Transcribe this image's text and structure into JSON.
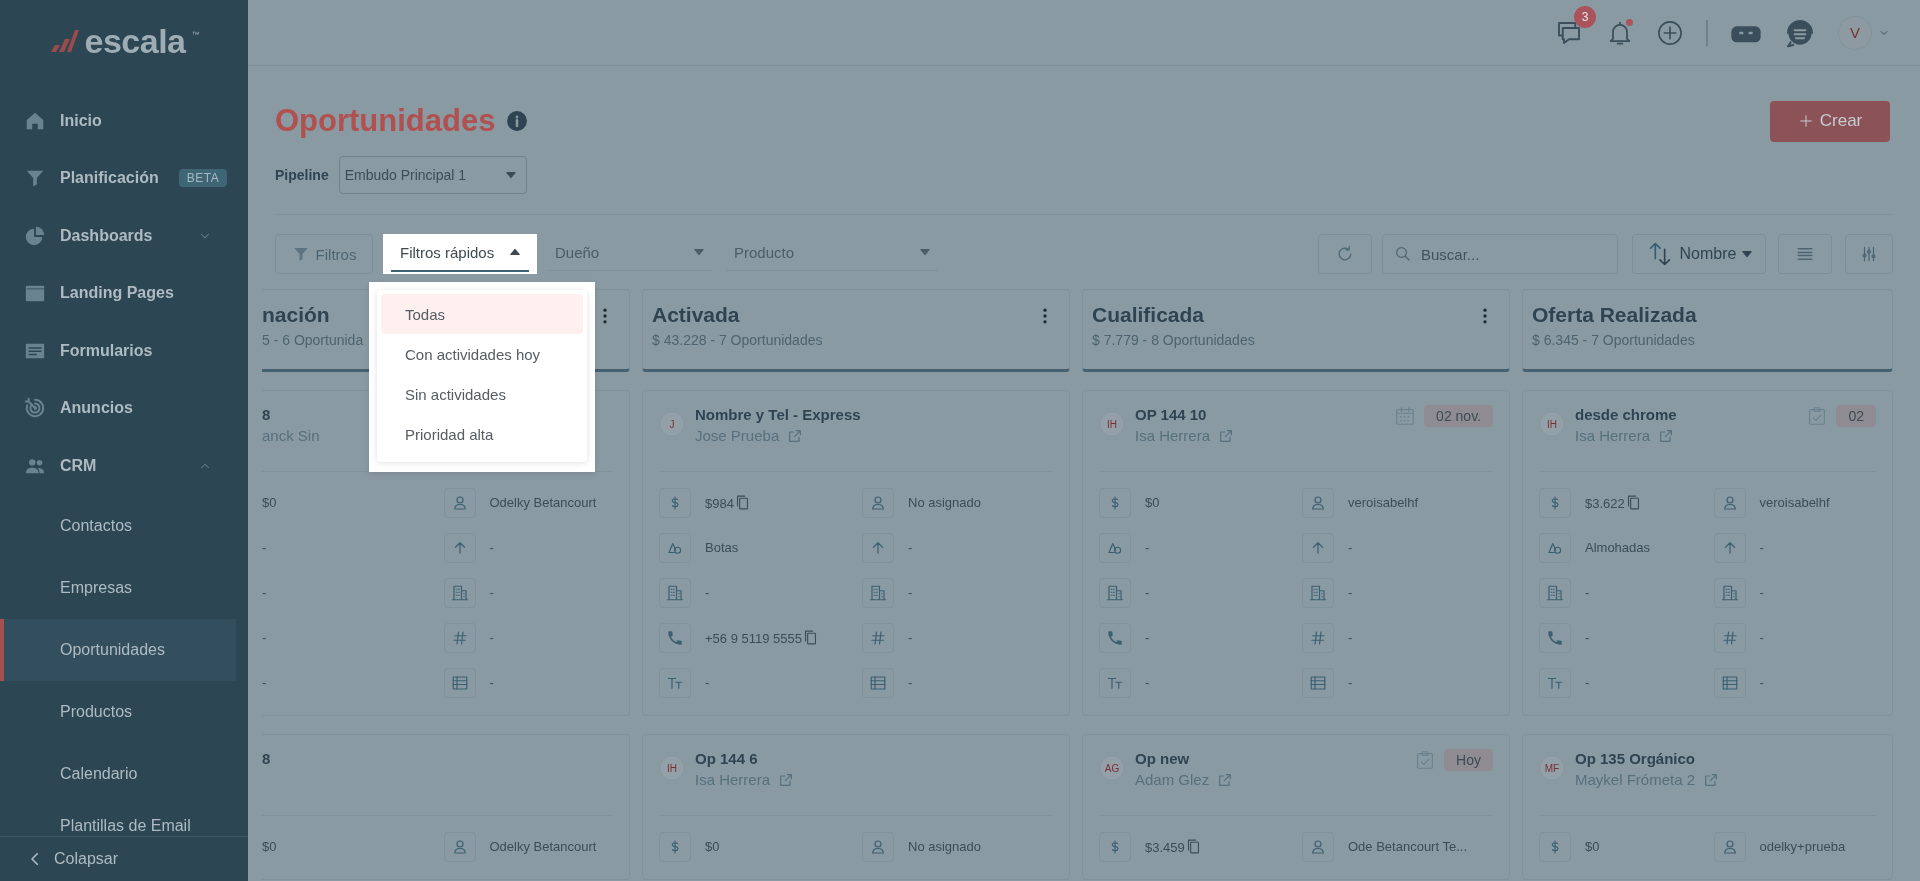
{
  "sidebar": {
    "logo": "escala",
    "logo_mark": "™",
    "items": [
      {
        "label": "Inicio",
        "kind": "home",
        "selected": false
      },
      {
        "label": "Planificación",
        "kind": "filter",
        "badge": "BETA",
        "selected": false
      },
      {
        "label": "Dashboards",
        "kind": "pie",
        "expanded": false,
        "selected": false
      },
      {
        "label": "Landing Pages",
        "kind": "window",
        "selected": false
      },
      {
        "label": "Formularios",
        "kind": "form",
        "selected": false
      },
      {
        "label": "Anuncios",
        "kind": "target",
        "selected": false
      },
      {
        "label": "CRM",
        "kind": "people",
        "expanded": true,
        "selected": false,
        "children": [
          {
            "label": "Contactos",
            "selected": false
          },
          {
            "label": "Empresas",
            "selected": false
          },
          {
            "label": "Oportunidades",
            "selected": true
          },
          {
            "label": "Productos",
            "selected": false
          },
          {
            "label": "Calendario",
            "selected": false
          },
          {
            "label": "Plantillas de Email",
            "selected": false
          }
        ]
      }
    ],
    "collapse": "Colapsar"
  },
  "topbar": {
    "messages_count": "3",
    "notifications_unread": true,
    "avatar": "V"
  },
  "page": {
    "title": "Oportunidades",
    "create_button": "Crear",
    "pipeline_label": "Pipeline",
    "pipeline_value": "Embudo Principal 1"
  },
  "filters": {
    "filters_button": "Filtros",
    "quick_filters": {
      "label": "Filtros rápidos",
      "expanded": true,
      "options": [
        {
          "label": "Todas",
          "selected": true
        },
        {
          "label": "Con actividades hoy",
          "selected": false
        },
        {
          "label": "Sin actividades",
          "selected": false
        },
        {
          "label": "Prioridad alta",
          "selected": false
        }
      ]
    },
    "owner_select": "Dueño",
    "product_select": "Producto",
    "search": {
      "placeholder": "Buscar..."
    },
    "sort": "Nombre"
  },
  "board": {
    "columns": [
      {
        "title": "nación",
        "summary": "5 - 6 Oportunida",
        "menu": true,
        "partial": true,
        "cards": [
          {
            "title": "8",
            "owner": "anck Sin",
            "fields": [
              {
                "kind": "bare",
                "value": "$0",
                "copy": false
              },
              {
                "kind": "owner",
                "value": "Odelky Betancourt",
                "copy": false
              },
              {
                "kind": "bare",
                "value": "-",
                "copy": false
              },
              {
                "kind": "priority",
                "value": "-",
                "copy": false
              },
              {
                "kind": "bare",
                "value": "-",
                "copy": false
              },
              {
                "kind": "company",
                "value": "-",
                "copy": false
              },
              {
                "kind": "bare",
                "value": "-",
                "copy": false
              },
              {
                "kind": "number",
                "value": "-",
                "copy": false
              },
              {
                "kind": "bare",
                "value": "-",
                "copy": false
              },
              {
                "kind": "table",
                "value": "-",
                "copy": false
              }
            ]
          },
          {
            "title": "8",
            "fields": [
              {
                "kind": "bare",
                "value": "$0",
                "copy": false
              },
              {
                "kind": "owner",
                "value": "Odelky Betancourt",
                "copy": false
              }
            ]
          }
        ]
      },
      {
        "title": "Activada",
        "summary": "$ 43.228 - 7 Oportunidades",
        "menu": true,
        "partial": false,
        "cards": [
          {
            "avatar": "J",
            "title": "Nombre y Tel - Express",
            "owner": "Jose Prueba",
            "fields": [
              {
                "kind": "amount",
                "value": "$984",
                "copy": true
              },
              {
                "kind": "owner",
                "value": "No asignado",
                "copy": false
              },
              {
                "kind": "product",
                "value": "Botas",
                "copy": false
              },
              {
                "kind": "priority",
                "value": "-",
                "copy": false
              },
              {
                "kind": "company",
                "value": "-",
                "copy": false
              },
              {
                "kind": "company",
                "value": "-",
                "copy": false
              },
              {
                "kind": "phone",
                "value": "+56 9 5119 5555",
                "copy": true
              },
              {
                "kind": "number",
                "value": "-",
                "copy": false
              },
              {
                "kind": "text",
                "value": "-",
                "copy": false
              },
              {
                "kind": "table",
                "value": "-",
                "copy": false
              }
            ]
          },
          {
            "avatar": "IH",
            "title": "Op 144 6",
            "owner": "Isa Herrera",
            "fields": [
              {
                "kind": "amount",
                "value": "$0",
                "copy": false
              },
              {
                "kind": "owner",
                "value": "No asignado",
                "copy": false
              }
            ]
          }
        ]
      },
      {
        "title": "Cualificada",
        "summary": "$ 7.779 - 8 Oportunidades",
        "menu": true,
        "partial": false,
        "cards": [
          {
            "avatar": "IH",
            "title": "OP 144 10",
            "owner": "Isa Herrera",
            "activity": {
              "kind": "calendar",
              "label": "02 nov."
            },
            "fields": [
              {
                "kind": "amount",
                "value": "$0",
                "copy": false
              },
              {
                "kind": "owner",
                "value": "veroisabelhf",
                "copy": false
              },
              {
                "kind": "product",
                "value": "-",
                "copy": false
              },
              {
                "kind": "priority",
                "value": "-",
                "copy": false
              },
              {
                "kind": "company",
                "value": "-",
                "copy": false
              },
              {
                "kind": "company",
                "value": "-",
                "copy": false
              },
              {
                "kind": "phone",
                "value": "-",
                "copy": false
              },
              {
                "kind": "number",
                "value": "-",
                "copy": false
              },
              {
                "kind": "text",
                "value": "-",
                "copy": false
              },
              {
                "kind": "table",
                "value": "-",
                "copy": false
              }
            ]
          },
          {
            "avatar": "AG",
            "title": "Op new",
            "owner": "Adam Glez",
            "activity": {
              "kind": "task",
              "label": "Hoy"
            },
            "fields": [
              {
                "kind": "amount",
                "value": "$3.459",
                "copy": true
              },
              {
                "kind": "owner",
                "value": "Ode Betancourt Te...",
                "copy": false
              }
            ]
          }
        ]
      },
      {
        "title": "Oferta Realizada",
        "summary": "$ 6.345 - 7 Oportunidades",
        "menu": false,
        "partial": false,
        "cards": [
          {
            "avatar": "IH",
            "title": "desde chrome",
            "owner": "Isa Herrera",
            "activity": {
              "kind": "task",
              "label": "02"
            },
            "fields": [
              {
                "kind": "amount",
                "value": "$3.622",
                "copy": true
              },
              {
                "kind": "owner",
                "value": "veroisabelhf",
                "copy": false
              },
              {
                "kind": "product",
                "value": "Almohadas",
                "copy": false
              },
              {
                "kind": "priority",
                "value": "-",
                "copy": false
              },
              {
                "kind": "company",
                "value": "-",
                "copy": false
              },
              {
                "kind": "company",
                "value": "-",
                "copy": false
              },
              {
                "kind": "phone",
                "value": "-",
                "copy": false
              },
              {
                "kind": "number",
                "value": "-",
                "copy": false
              },
              {
                "kind": "text",
                "value": "-",
                "copy": false
              },
              {
                "kind": "table",
                "value": "-",
                "copy": false
              }
            ]
          },
          {
            "avatar": "MF",
            "title": "Op 135 Orgánico",
            "owner": "Maykel Frómeta 2",
            "fields": [
              {
                "kind": "amount",
                "value": "$0",
                "copy": false
              },
              {
                "kind": "owner",
                "value": "odelky+prueba",
                "copy": false
              }
            ]
          }
        ]
      }
    ]
  }
}
